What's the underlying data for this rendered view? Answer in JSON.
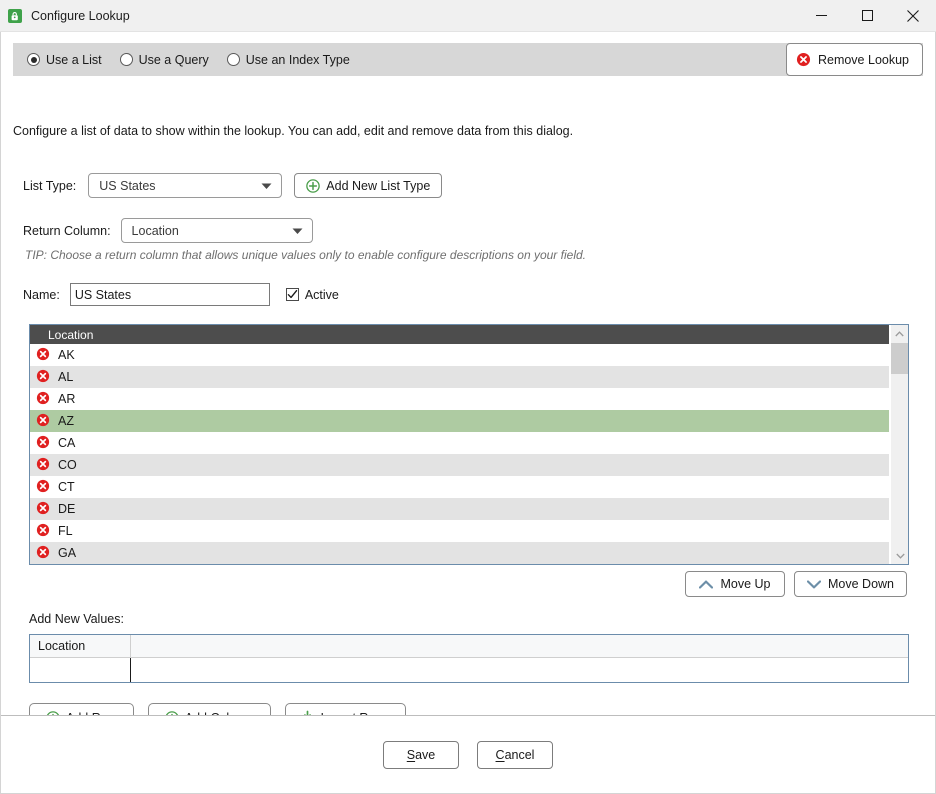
{
  "window": {
    "title": "Configure Lookup",
    "icon": "lookup-app-icon",
    "controls": {
      "minimize": "minimize-icon",
      "maximize": "maximize-icon",
      "close": "close-icon"
    }
  },
  "mode": {
    "options": [
      {
        "label": "Use a List",
        "selected": true
      },
      {
        "label": "Use a Query",
        "selected": false
      },
      {
        "label": "Use an Index Type",
        "selected": false
      }
    ],
    "remove_lookup_label": "Remove Lookup",
    "remove_lookup_icon": "red-x-circle-icon"
  },
  "description": "Configure a list of data to show within the lookup. You can add, edit and remove data from this dialog.",
  "form": {
    "list_type_label": "List Type:",
    "list_type_value": "US States",
    "add_new_list_type_label": "Add New List Type",
    "add_new_list_type_icon": "green-plus-circle-icon",
    "return_column_label": "Return Column:",
    "return_column_value": "Location",
    "tip": "TIP: Choose a return column that allows unique values only to enable configure descriptions on your field.",
    "name_label": "Name:",
    "name_value": "US States",
    "active_label": "Active",
    "active_checked": true
  },
  "grid": {
    "column_header": "Location",
    "delete_icon": "red-x-circle-icon",
    "rows": [
      {
        "value": "AK",
        "selected": false
      },
      {
        "value": "AL",
        "selected": false
      },
      {
        "value": "AR",
        "selected": false
      },
      {
        "value": "AZ",
        "selected": true
      },
      {
        "value": "CA",
        "selected": false
      },
      {
        "value": "CO",
        "selected": false
      },
      {
        "value": "CT",
        "selected": false
      },
      {
        "value": "DE",
        "selected": false
      },
      {
        "value": "FL",
        "selected": false
      },
      {
        "value": "GA",
        "selected": false
      }
    ],
    "scrollbar": {
      "up_icon": "chevron-up-icon",
      "down_icon": "chevron-down-icon"
    }
  },
  "reorder": {
    "move_up_label": "Move Up",
    "move_up_icon": "chevron-up-icon",
    "move_down_label": "Move Down",
    "move_down_icon": "chevron-down-icon"
  },
  "add_new_values": {
    "label": "Add New Values:",
    "column_header": "Location",
    "new_row_value": ""
  },
  "actions": {
    "add_row_label": "Add Row",
    "add_row_icon": "green-plus-circle-icon",
    "add_column_label": "Add Column",
    "add_column_icon": "green-plus-circle-icon",
    "import_rows_label": "Import Rows",
    "import_rows_icon": "import-download-icon"
  },
  "footer": {
    "save_label": "Save",
    "save_accel": "S",
    "save_rest": "ave",
    "cancel_label": "Cancel",
    "cancel_accel": "C",
    "cancel_rest": "ancel"
  },
  "colors": {
    "selection_green": "#aecba2",
    "header_gray": "#4d4d4d",
    "grid_border_blue": "#6b8cab",
    "icon_red": "#e02020",
    "icon_green": "#4a9e4a",
    "chevron_blue": "#6d8fa8"
  }
}
